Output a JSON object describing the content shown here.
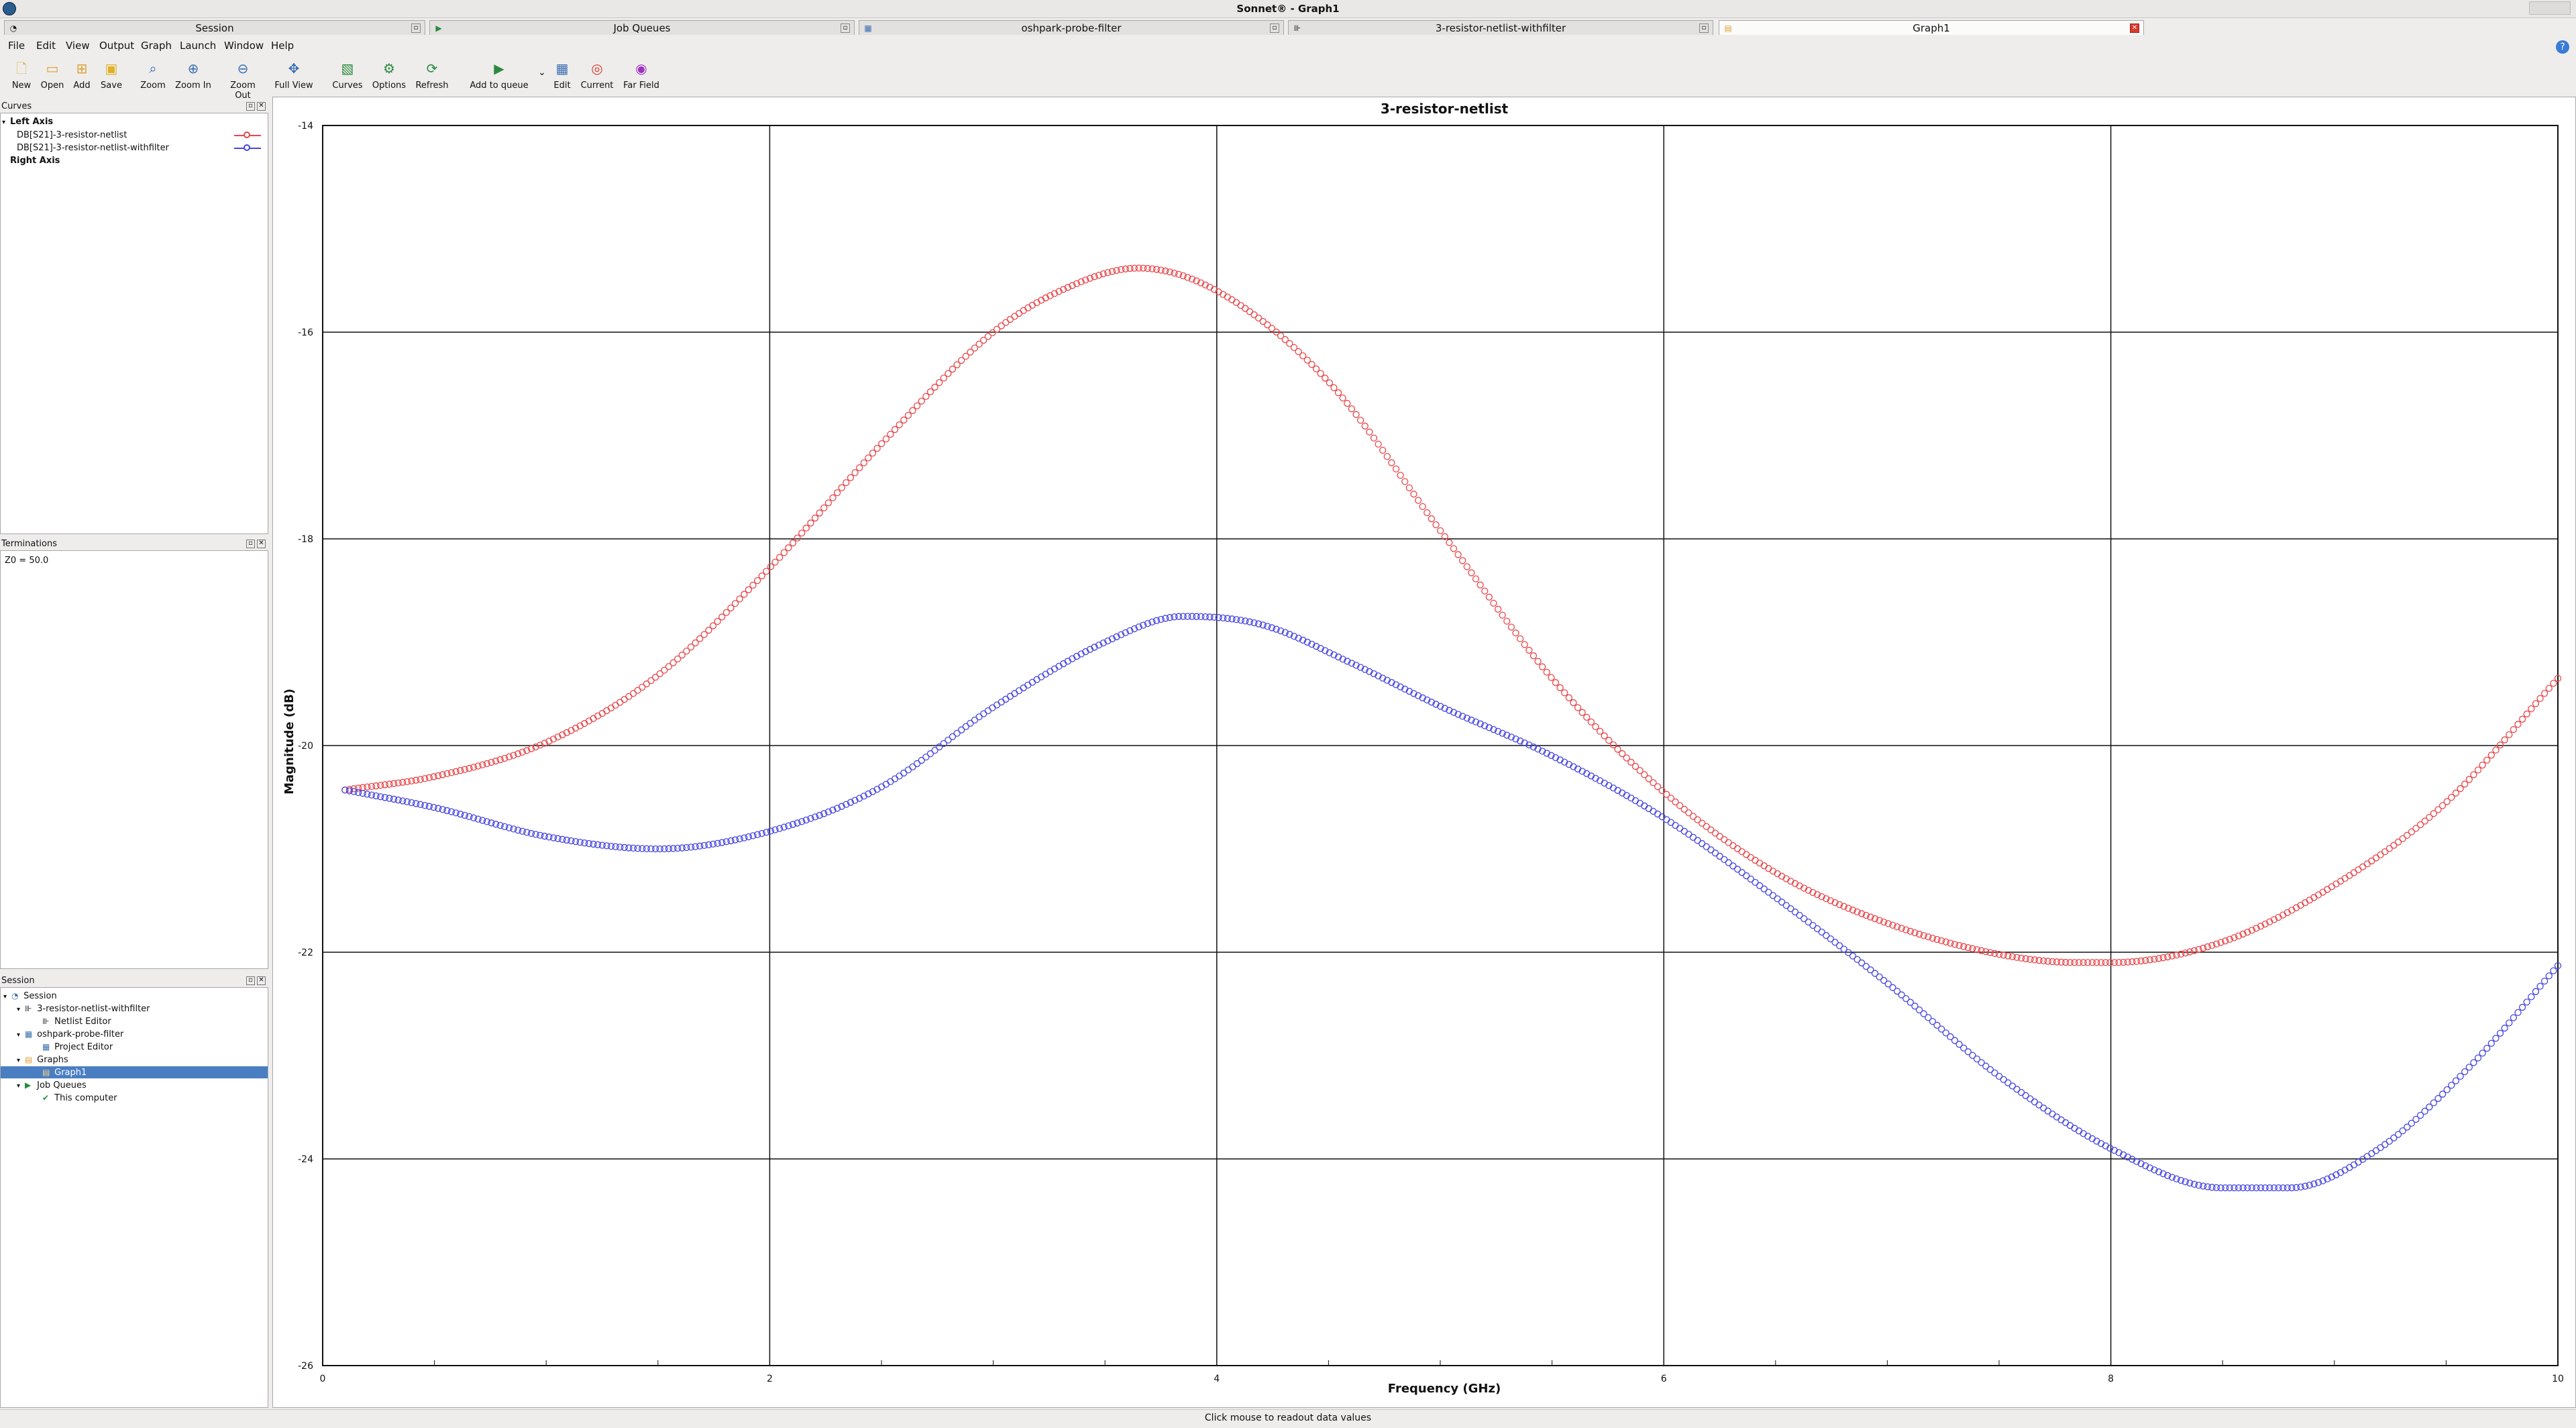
{
  "window": {
    "title": "Sonnet® - Graph1"
  },
  "tabs": [
    {
      "label": "Session",
      "icon": "session-icon"
    },
    {
      "label": "Job Queues",
      "icon": "job-queue-icon"
    },
    {
      "label": "oshpark-probe-filter",
      "icon": "project-icon"
    },
    {
      "label": "3-resistor-netlist-withfilter",
      "icon": "netlist-icon"
    },
    {
      "label": "Graph1",
      "icon": "graph-icon",
      "active": true
    }
  ],
  "menu": [
    "File",
    "Edit",
    "View",
    "Output",
    "Graph",
    "Launch",
    "Window",
    "Help"
  ],
  "toolbar": [
    {
      "label": "New",
      "icon": "new-file-icon"
    },
    {
      "label": "Open",
      "icon": "open-folder-icon"
    },
    {
      "label": "Add",
      "icon": "add-folder-icon"
    },
    {
      "label": "Save",
      "icon": "save-icon"
    },
    {
      "label": "Zoom",
      "icon": "zoom-icon"
    },
    {
      "label": "Zoom In",
      "icon": "zoom-in-icon"
    },
    {
      "label": "Zoom Out",
      "icon": "zoom-out-icon"
    },
    {
      "label": "Full View",
      "icon": "full-view-icon"
    },
    {
      "label": "Curves",
      "icon": "curves-icon"
    },
    {
      "label": "Options",
      "icon": "options-icon"
    },
    {
      "label": "Refresh",
      "icon": "refresh-icon"
    },
    {
      "label": "Add to queue",
      "icon": "add-to-queue-icon"
    },
    {
      "label": "Edit",
      "icon": "edit-icon"
    },
    {
      "label": "Current",
      "icon": "current-icon"
    },
    {
      "label": "Far Field",
      "icon": "far-field-icon"
    }
  ],
  "curves_panel": {
    "title": "Curves",
    "left_axis": "Left Axis",
    "right_axis": "Right Axis",
    "items": [
      {
        "label": "DB[S21]-3-resistor-netlist",
        "color": "#e8474b"
      },
      {
        "label": "DB[S21]-3-resistor-netlist-withfilter",
        "color": "#4646e0"
      }
    ]
  },
  "terminations_panel": {
    "title": "Terminations",
    "value": "Z0 = 50.0"
  },
  "session_panel": {
    "title": "Session",
    "tree": [
      {
        "label": "Session",
        "level": 0,
        "icon": "session-icon"
      },
      {
        "label": "3-resistor-netlist-withfilter",
        "level": 1,
        "icon": "netlist-icon"
      },
      {
        "label": "Netlist Editor",
        "level": 2,
        "icon": "netlist-editor-icon"
      },
      {
        "label": "oshpark-probe-filter",
        "level": 1,
        "icon": "project-icon"
      },
      {
        "label": "Project Editor",
        "level": 2,
        "icon": "project-editor-icon"
      },
      {
        "label": "Graphs",
        "level": 1,
        "icon": "graphs-folder-icon"
      },
      {
        "label": "Graph1",
        "level": 2,
        "icon": "graph-icon",
        "selected": true
      },
      {
        "label": "Job Queues",
        "level": 1,
        "icon": "job-queue-icon"
      },
      {
        "label": "This computer",
        "level": 2,
        "icon": "computer-check-icon"
      }
    ]
  },
  "status": "Click mouse to readout data values",
  "chart_data": {
    "type": "scatter",
    "title": "3-resistor-netlist",
    "xlabel": "Frequency (GHz)",
    "ylabel": "Magnitude (dB)",
    "xlim": [
      0,
      10
    ],
    "ylim": [
      -26,
      -14
    ],
    "xticks": [
      0,
      2,
      4,
      6,
      8,
      10
    ],
    "yticks": [
      -14,
      -16,
      -18,
      -20,
      -22,
      -24,
      -26
    ],
    "grid": true,
    "series": [
      {
        "name": "DB[S21]-3-resistor-netlist",
        "color": "#e8474b",
        "x": [
          0.1,
          0.5,
          1.0,
          1.5,
          2.0,
          2.5,
          3.0,
          3.3,
          3.65,
          4.0,
          4.5,
          5.0,
          5.5,
          6.0,
          6.5,
          7.0,
          7.5,
          7.85,
          8.0,
          8.5,
          9.0,
          9.5,
          10.0
        ],
        "values": [
          -20.43,
          -20.3,
          -19.97,
          -19.32,
          -18.28,
          -17.08,
          -16.0,
          -15.6,
          -15.38,
          -15.6,
          -16.48,
          -17.92,
          -19.35,
          -20.45,
          -21.23,
          -21.72,
          -22.02,
          -22.1,
          -22.1,
          -21.9,
          -21.35,
          -20.55,
          -19.35
        ]
      },
      {
        "name": "DB[S21]-3-resistor-netlist-withfilter",
        "color": "#4646e0",
        "x": [
          0.1,
          0.5,
          1.0,
          1.5,
          2.0,
          2.5,
          3.0,
          3.5,
          3.85,
          4.2,
          4.6,
          5.0,
          5.5,
          6.0,
          6.5,
          7.0,
          7.5,
          8.0,
          8.5,
          8.8,
          9.2,
          9.6,
          10.0
        ],
        "values": [
          -20.43,
          -20.6,
          -20.88,
          -21.0,
          -20.83,
          -20.4,
          -19.63,
          -19.0,
          -18.75,
          -18.83,
          -19.2,
          -19.62,
          -20.1,
          -20.7,
          -21.47,
          -22.3,
          -23.2,
          -23.9,
          -24.28,
          -24.28,
          -23.9,
          -23.12,
          -22.13
        ]
      }
    ]
  }
}
